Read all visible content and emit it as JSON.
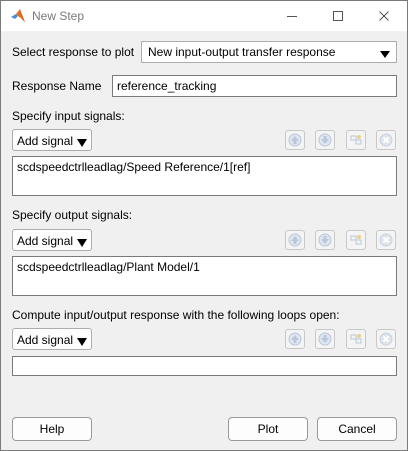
{
  "window": {
    "title": "New Step"
  },
  "response": {
    "label": "Select response to plot",
    "selected": "New input-output transfer response"
  },
  "response_name": {
    "label": "Response Name",
    "value": "reference_tracking"
  },
  "inputs": {
    "label": "Specify input signals:",
    "add_label": "Add signal",
    "items": [
      "scdspeedctrlleadlag/Speed Reference/1[ref]"
    ]
  },
  "outputs": {
    "label": "Specify output signals:",
    "add_label": "Add signal",
    "items": [
      "scdspeedctrlleadlag/Plant Model/1"
    ]
  },
  "openings": {
    "label": "Compute input/output response with the following loops open:",
    "add_label": "Add signal",
    "items": []
  },
  "buttons": {
    "help": "Help",
    "plot": "Plot",
    "cancel": "Cancel"
  },
  "colors": {
    "arrow_up_disabled": "#b9c7da",
    "delete_disabled": "#c9d2df"
  },
  "icons": {
    "app": "matlab-logo-icon",
    "minimize": "minimize-icon",
    "maximize": "maximize-icon",
    "close": "close-icon"
  }
}
